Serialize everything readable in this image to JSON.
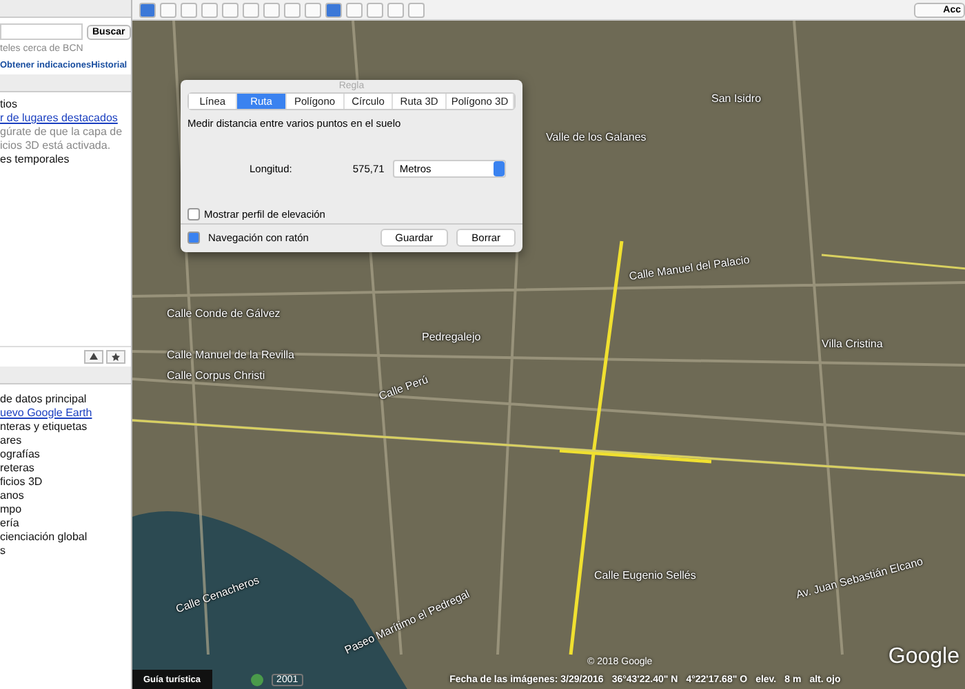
{
  "sidebar": {
    "search": {
      "button": "Buscar",
      "hint": "teles cerca de BCN"
    },
    "links": [
      {
        "label": "Obtener indicaciones"
      },
      {
        "label": "Historial"
      }
    ],
    "places": [
      {
        "kind": "text",
        "label": "tios"
      },
      {
        "kind": "link",
        "label": "r de lugares destacados"
      },
      {
        "kind": "note",
        "label": "gúrate de que la capa de"
      },
      {
        "kind": "note",
        "label": "icios 3D está activada."
      },
      {
        "kind": "text",
        "label": "es temporales"
      }
    ],
    "layers": [
      {
        "kind": "text",
        "label": "de datos principal"
      },
      {
        "kind": "link",
        "label": "uevo Google Earth"
      },
      {
        "kind": "text",
        "label": "nteras y etiquetas"
      },
      {
        "kind": "text",
        "label": "ares"
      },
      {
        "kind": "text",
        "label": "ografías"
      },
      {
        "kind": "text",
        "label": "reteras"
      },
      {
        "kind": "text",
        "label": "ficios 3D"
      },
      {
        "kind": "text",
        "label": "anos"
      },
      {
        "kind": "text",
        "label": "mpo"
      },
      {
        "kind": "text",
        "label": "ería"
      },
      {
        "kind": "text",
        "label": "cienciación global"
      },
      {
        "kind": "text",
        "label": "s"
      }
    ]
  },
  "toolbar": {
    "account_button": "Acc"
  },
  "ruler": {
    "title": "Regla",
    "tabs": [
      {
        "label": "Línea",
        "selected": false
      },
      {
        "label": "Ruta",
        "selected": true
      },
      {
        "label": "Polígono",
        "selected": false
      },
      {
        "label": "Círculo",
        "selected": false
      },
      {
        "label": "Ruta 3D",
        "selected": false
      },
      {
        "label": "Polígono 3D",
        "selected": false
      }
    ],
    "description": "Medir distancia entre varios puntos en el suelo",
    "length_label": "Longitud:",
    "length_value": "575,71",
    "unit": "Metros",
    "elevation_profile": {
      "label": "Mostrar perfil de elevación",
      "checked": false
    },
    "mouse_navigation": {
      "label": "Navegación con ratón",
      "checked": true
    },
    "buttons": [
      "Guardar",
      "Borrar"
    ]
  },
  "map": {
    "labels": [
      "Valle de los Galanes",
      "San Isidro",
      "Calle Manuel del Palacio",
      "Calle Conde de Gálvez",
      "Calle Manuel de la Revilla",
      "Calle Corpus Christi",
      "Pedregalejo",
      "Villa Cristina",
      "Calle Perú",
      "Calle Eugenio Sellés",
      "Av. Juan Sebastián Elcano",
      "Calle Cenacheros",
      "Paseo Marítimo el Pedregal"
    ],
    "copyright": "© 2018 Google",
    "logo": "Google"
  },
  "status_bar": {
    "tour_button": "Guía turística",
    "year": "2001",
    "imagery_date": "Fecha de las imágenes: 3/29/2016",
    "latitude": "36°43'22.40\" N",
    "longitude": "4°22'17.68\" O",
    "elevation_label": "elev.",
    "elevation": "8 m",
    "eye_altitude": "alt. ojo"
  }
}
